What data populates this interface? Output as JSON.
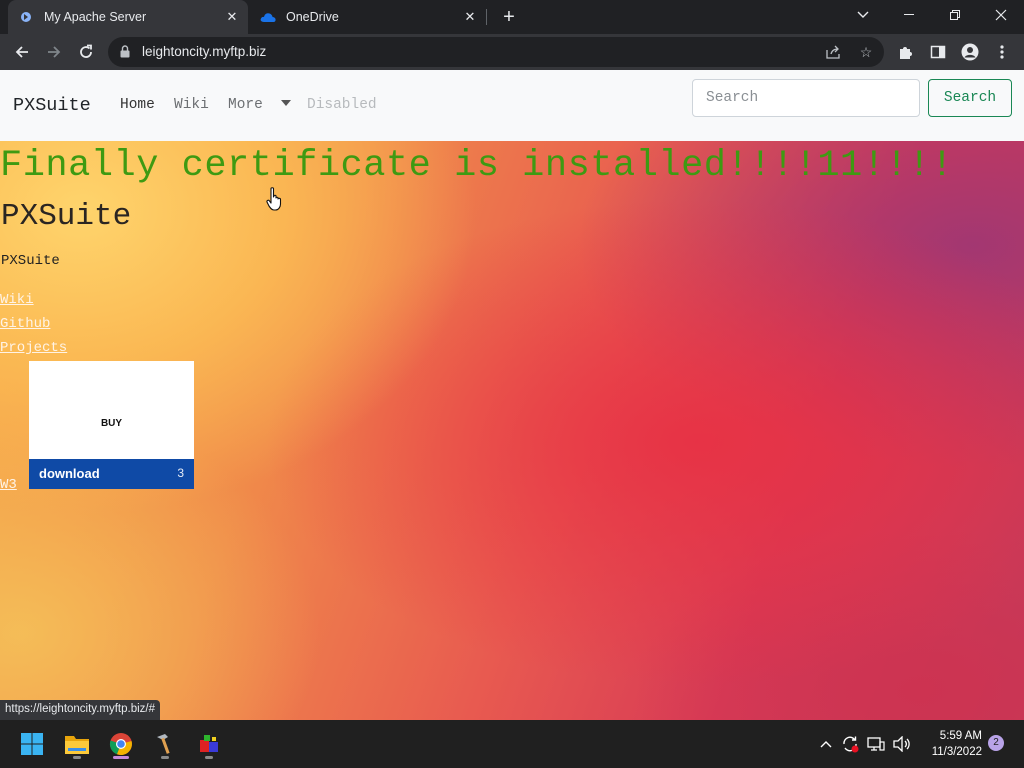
{
  "browser": {
    "tabs": [
      {
        "title": "My Apache Server",
        "icon": "apache-favicon-icon",
        "active": true
      },
      {
        "title": "OneDrive",
        "icon": "onedrive-cloud-icon",
        "active": false
      }
    ],
    "url": "leightoncity.myftp.biz",
    "status_url": "https://leightoncity.myftp.biz/#",
    "colors": {
      "tabstrip": "#202124",
      "toolbar": "#35363a"
    }
  },
  "navbar": {
    "brand": "PXSuite",
    "links": {
      "home": "Home",
      "wiki": "Wiki",
      "more": "More",
      "disabled": "Disabled"
    },
    "search": {
      "placeholder": "Search",
      "button_label": "Search"
    }
  },
  "hero": {
    "heading": "Finally certificate is installed!!!!11!!!!",
    "subtitle": "PXSuite",
    "text": "PXSuite",
    "links": {
      "wiki": "Wiki",
      "github": "Github",
      "projects": "Projects",
      "w3": "W3"
    },
    "buy_card": {
      "label": "BUY",
      "download_label": "download",
      "count": "3"
    },
    "colors": {
      "heading": "#3e9a12",
      "card_footer": "#0f4aa6"
    }
  },
  "taskbar": {
    "apps": [
      "windows-start-icon",
      "file-explorer-icon",
      "chrome-icon",
      "hammer-icon",
      "colorful-app-icon"
    ],
    "time": "5:59 AM",
    "date": "11/3/2022",
    "notification_count": "2"
  }
}
